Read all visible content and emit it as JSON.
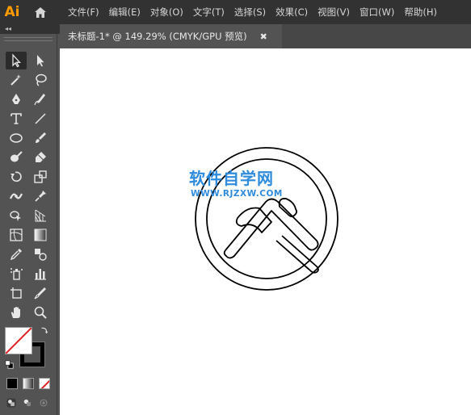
{
  "app": {
    "logo_text": "Ai"
  },
  "menu": {
    "items": [
      "文件(F)",
      "编辑(E)",
      "对象(O)",
      "文字(T)",
      "选择(S)",
      "效果(C)",
      "视图(V)",
      "窗口(W)",
      "帮助(H)"
    ]
  },
  "toolbar": {
    "collapse_label": "◂◂",
    "tools": [
      "selection-tool",
      "direct-selection-tool",
      "magic-wand-tool",
      "lasso-tool",
      "pen-tool",
      "curvature-tool",
      "type-tool",
      "line-segment-tool",
      "ellipse-tool",
      "paintbrush-tool",
      "blob-brush-tool",
      "eraser-tool",
      "rotate-tool",
      "scale-tool",
      "width-tool",
      "puppet-warp-tool",
      "shape-builder-tool",
      "perspective-grid-tool",
      "mesh-tool",
      "gradient-tool",
      "eyedropper-tool",
      "blend-tool",
      "symbol-sprayer-tool",
      "column-graph-tool",
      "artboard-tool",
      "slice-tool",
      "hand-tool",
      "zoom-tool"
    ]
  },
  "document": {
    "tab_title": "未标题-1* @ 149.29% (CMYK/GPU 预览)",
    "tab_close": "✖"
  },
  "canvas": {
    "watermark_title": "软件自学网",
    "watermark_url": "WWW.RJZXW.COM"
  },
  "colors": {
    "menubar": "#323232",
    "panel": "#535353",
    "accent": "#ff9a00",
    "watermark": "#2f8bdc"
  }
}
